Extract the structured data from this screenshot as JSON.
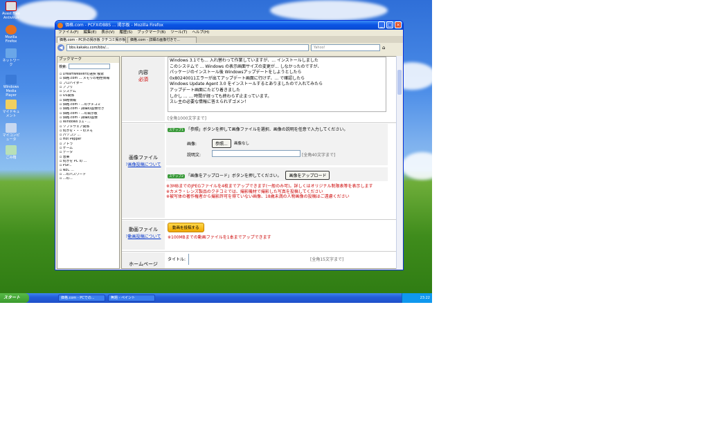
{
  "desktop_icons": [
    "Avast Free Antivirus",
    "Mozilla Firefox",
    "ネットワーク",
    "Windows Media Player",
    "マイドキュメント",
    "マイコンピュータ",
    "ごみ箱"
  ],
  "window": {
    "title": "価格.com - PCFXのBBS ... 掲示板 - Mozilla Firefox",
    "menu": [
      "ファイル(F)",
      "編集(E)",
      "表示(V)",
      "履歴(S)",
      "ブックマーク(B)",
      "ツール(T)",
      "ヘルプ(H)"
    ],
    "tabs": [
      "価格.com - PC外の掲示板 クチコミ掲示板 ×",
      "価格.com - 詳細の画像付きで..."
    ],
    "url": "bbs.kakaku.com/bbs/...",
    "search_placeholder": "Yahoo!"
  },
  "sidebar": {
    "title": "ブックマーク",
    "search_label": "検索:",
    "items": [
      "Dreamweaverの選択 検索",
      "価格.com ... メモリの相性情報",
      "プロバイダー",
      "アプリ",
      "システム",
      "OS関係",
      "価格情報",
      "価格.com - ...のクチコミ",
      "価格.com - 詳細の画像付き",
      "価格.com - ...の掲示板",
      "価格.com - 詳細の画像",
      "Windows 3.1 - ...",
      "ソフトウェア関係",
      "何かを・・・のメモ",
      "パソコン ...",
      "Hot Pepper",
      "アトラ",
      "ゲーム",
      "データ",
      "音楽",
      "何かを PC の ...",
      "PSP... ",
      "NEC ...",
      "...のパスワード",
      "...の..."
    ]
  },
  "form": {
    "content_label": "内容",
    "required": "必須",
    "content_lines": [
      "Windows 3.1でも... 入れ替わって作業していますが、... インストールしました",
      "このシステムで ... Windows の表示画面サイズの変更が... しなかったのですが、",
      "パッケージのインストール後 Windowsアップデートをしようとしたら",
      "0x80240011エラーが出てアップデート画面に行けず、... で確認したら",
      "Windows Update Agent 3.0 をインストールするとありましたので入れてみたら",
      "アップデート画面にたどり着きました",
      "しかし ... ... 時間が経っても終わらず止まっています。",
      "スレ主の必要な情報に答えられずゴメン！"
    ],
    "content_counter": "[全角1000文字まで]",
    "image_label": "画像ファイル",
    "image_help": "画像投稿について",
    "step1": "ステップ1",
    "step1_text": "「参照」ボタンを押して画像ファイルを選択、画像の説明を任意で入力してください。",
    "file_label": "画像:",
    "browse_button": "参照...",
    "file_status": "画像なし",
    "desc_label": "説明文:",
    "desc_counter": "[全角40文字まで]",
    "step2": "ステップ2",
    "step2_text": "「画像をアップロード」ボタンを押してください。",
    "upload_button": "画像をアップロード",
    "warnings": [
      "※3MBまでのJPEGファイルを4枚までアップできます(一般のみ可)。詳しくはオリジナル制限表等を表示します",
      "※カメラ・レンズ製品のクチコミでは、撮影機材で撮影した写真を投稿してください",
      "※被写体の著作権者から撮影許可を得ていない画像、18歳未満の人物画像の投稿はご遠慮ください"
    ],
    "video_label": "動画ファイル",
    "video_help": "動画投稿について",
    "video_button": "動画を投稿する",
    "video_note": "※100MBまでの動画ファイルを1本までアップできます",
    "homepage_label": "ホームページ",
    "homepage_title_label": "タイトル:",
    "homepage_counter": "[全角15文字まで]"
  },
  "taskbar": {
    "start": "スタート",
    "tasks": [
      "価格.com - PCでの...",
      "無題 - ペイント"
    ],
    "clock": "23:22"
  }
}
